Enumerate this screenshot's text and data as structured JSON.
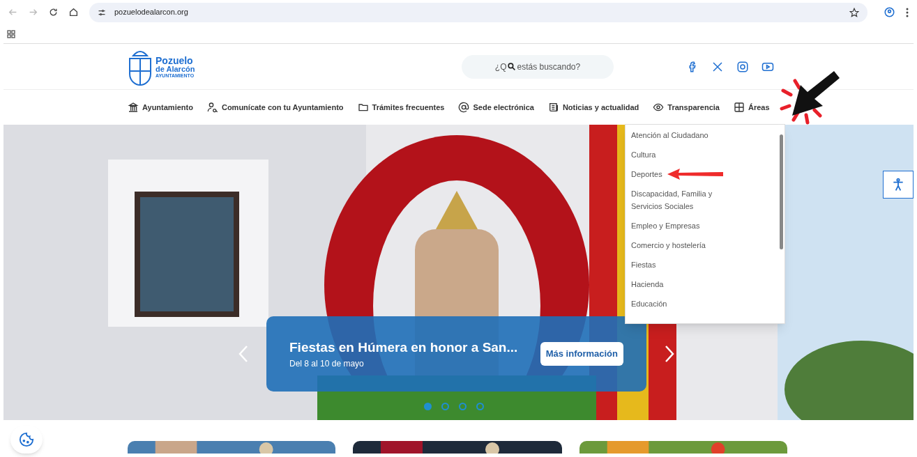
{
  "browser": {
    "url": "pozuelodealarcon.org"
  },
  "header": {
    "logo": {
      "name": "Pozuelo",
      "subname": "de Alarcón",
      "tagline": "AYUNTAMIENTO"
    },
    "search": {
      "placeholder_start": "¿Q",
      "placeholder_end": "estás buscando?"
    },
    "social": [
      {
        "kind": "facebook"
      },
      {
        "kind": "x"
      },
      {
        "kind": "instagram"
      },
      {
        "kind": "youtube"
      }
    ]
  },
  "nav": [
    {
      "label": "Ayuntamiento",
      "kind": "building"
    },
    {
      "label": "Comunícate con tu Ayuntamiento",
      "kind": "person"
    },
    {
      "label": "Trámites frecuentes",
      "kind": "folder"
    },
    {
      "label": "Sede electrónica",
      "kind": "at"
    },
    {
      "label": "Noticias y actualidad",
      "kind": "news"
    },
    {
      "label": "Transparencia",
      "kind": "eye"
    },
    {
      "label": "Áreas",
      "kind": "grid"
    }
  ],
  "areas_menu": [
    "Atención al Ciudadano",
    "Cultura",
    "Deportes",
    "Discapacidad, Familia y Servicios Sociales",
    "Empleo y Empresas",
    "Comercio y hostelería",
    "Fiestas",
    "Hacienda",
    "Educación"
  ],
  "hero": {
    "title": "Fiestas en Húmera en honor a San...",
    "subtitle": "Del 8 al 10 de mayo",
    "button": "Más información",
    "dots": [
      {
        "selected": true
      },
      {
        "selected": false
      },
      {
        "selected": false
      },
      {
        "selected": false
      }
    ]
  }
}
